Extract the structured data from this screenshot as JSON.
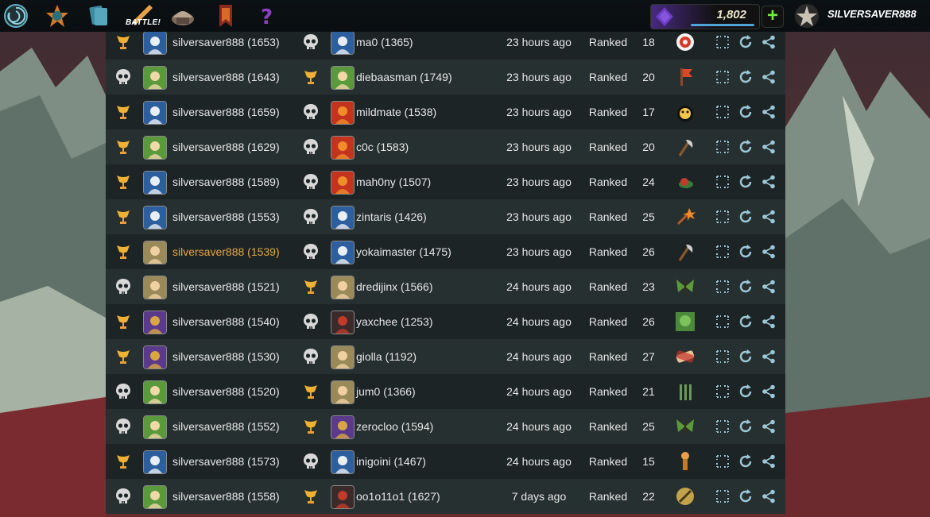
{
  "topbar": {
    "battle_label": "BATTLE!",
    "dec_balance": "1,802",
    "plus_label": "+",
    "username": "SILVERSAVER888",
    "nav_icons": [
      "splinterlands-logo-icon",
      "packs-icon",
      "cards-icon",
      "battle-icon",
      "shop-icon",
      "guild-banner-icon",
      "quest-icon"
    ]
  },
  "colors": {
    "row_odd": "#1d2426",
    "row_even": "#273030",
    "highlight": "#e7a544",
    "accent_green": "#6df03c",
    "action_blue": "#9cc7d6"
  },
  "rows": [
    {
      "p1_result": "trophy",
      "p1_avatar": "wizard-blue",
      "p1": "silversaver888 (1653)",
      "p2_result": "skull",
      "p2_avatar": "wizard-blue",
      "p2": "ma0 (1365)",
      "time": "23 hours ago",
      "mode": "Ranked",
      "mana": "18",
      "rule": "target-icon",
      "highlight": false
    },
    {
      "p1_result": "skull",
      "p1_avatar": "elf-green",
      "p1": "silversaver888 (1643)",
      "p2_result": "trophy",
      "p2_avatar": "elf-green",
      "p2": "diebaasman (1749)",
      "time": "23 hours ago",
      "mode": "Ranked",
      "mana": "20",
      "rule": "flag-icon",
      "highlight": false
    },
    {
      "p1_result": "trophy",
      "p1_avatar": "wizard-blue",
      "p1": "silversaver888 (1659)",
      "p2_result": "skull",
      "p2_avatar": "dragon-red",
      "p2": "mildmate (1538)",
      "time": "23 hours ago",
      "mode": "Ranked",
      "mana": "17",
      "rule": "bomb-icon",
      "highlight": false
    },
    {
      "p1_result": "trophy",
      "p1_avatar": "elf-green",
      "p1": "silversaver888 (1629)",
      "p2_result": "skull",
      "p2_avatar": "dragon-red",
      "p2": "c0c (1583)",
      "time": "23 hours ago",
      "mode": "Ranked",
      "mana": "20",
      "rule": "axe-icon",
      "highlight": false
    },
    {
      "p1_result": "trophy",
      "p1_avatar": "wizard-blue",
      "p1": "silversaver888 (1589)",
      "p2_result": "skull",
      "p2_avatar": "dragon-red",
      "p2": "mah0ny (1507)",
      "time": "23 hours ago",
      "mode": "Ranked",
      "mana": "24",
      "rule": "snail-icon",
      "highlight": false
    },
    {
      "p1_result": "trophy",
      "p1_avatar": "wizard-blue",
      "p1": "silversaver888 (1553)",
      "p2_result": "skull",
      "p2_avatar": "wizard-blue",
      "p2": "zintaris (1426)",
      "time": "23 hours ago",
      "mode": "Ranked",
      "mana": "25",
      "rule": "explosion-icon",
      "highlight": false
    },
    {
      "p1_result": "trophy",
      "p1_avatar": "human-tan",
      "p1": "silversaver888 (1539)",
      "p2_result": "skull",
      "p2_avatar": "wizard-blue",
      "p2": "yokaimaster (1475)",
      "time": "23 hours ago",
      "mode": "Ranked",
      "mana": "26",
      "rule": "axe-icon",
      "highlight": true
    },
    {
      "p1_result": "skull",
      "p1_avatar": "human-tan",
      "p1": "silversaver888 (1521)",
      "p2_result": "trophy",
      "p2_avatar": "human-tan",
      "p2": "dredijinx (1566)",
      "time": "24 hours ago",
      "mode": "Ranked",
      "mana": "23",
      "rule": "butterfly-icon",
      "highlight": false
    },
    {
      "p1_result": "trophy",
      "p1_avatar": "dwarf-purple",
      "p1": "silversaver888 (1540)",
      "p2_result": "skull",
      "p2_avatar": "beast-dark",
      "p2": "yaxchee (1253)",
      "time": "24 hours ago",
      "mode": "Ranked",
      "mana": "26",
      "rule": "goblin-icon",
      "highlight": false
    },
    {
      "p1_result": "trophy",
      "p1_avatar": "dwarf-purple",
      "p1": "silversaver888 (1530)",
      "p2_result": "skull",
      "p2_avatar": "human-tan",
      "p2": "giolla (1192)",
      "time": "24 hours ago",
      "mode": "Ranked",
      "mana": "27",
      "rule": "bandage-icon",
      "highlight": false
    },
    {
      "p1_result": "skull",
      "p1_avatar": "elf-green",
      "p1": "silversaver888 (1520)",
      "p2_result": "trophy",
      "p2_avatar": "human-tan",
      "p2": "jum0 (1366)",
      "time": "24 hours ago",
      "mode": "Ranked",
      "mana": "21",
      "rule": "swords-icon",
      "highlight": false
    },
    {
      "p1_result": "skull",
      "p1_avatar": "elf-green",
      "p1": "silversaver888 (1552)",
      "p2_result": "trophy",
      "p2_avatar": "dwarf-purple",
      "p2": "zerocloo (1594)",
      "time": "24 hours ago",
      "mode": "Ranked",
      "mana": "25",
      "rule": "butterfly-icon",
      "highlight": false
    },
    {
      "p1_result": "trophy",
      "p1_avatar": "wizard-blue",
      "p1": "silversaver888 (1573)",
      "p2_result": "skull",
      "p2_avatar": "wizard-blue",
      "p2": "inigoini (1467)",
      "time": "24 hours ago",
      "mode": "Ranked",
      "mana": "15",
      "rule": "totem-icon",
      "highlight": false
    },
    {
      "p1_result": "skull",
      "p1_avatar": "elf-green",
      "p1": "silversaver888 (1558)",
      "p2_result": "trophy",
      "p2_avatar": "beast-dark",
      "p2": "oo1o11o1 (1627)",
      "time": "7 days ago",
      "mode": "Ranked",
      "mana": "22",
      "rule": "shield-icon",
      "highlight": false
    }
  ]
}
